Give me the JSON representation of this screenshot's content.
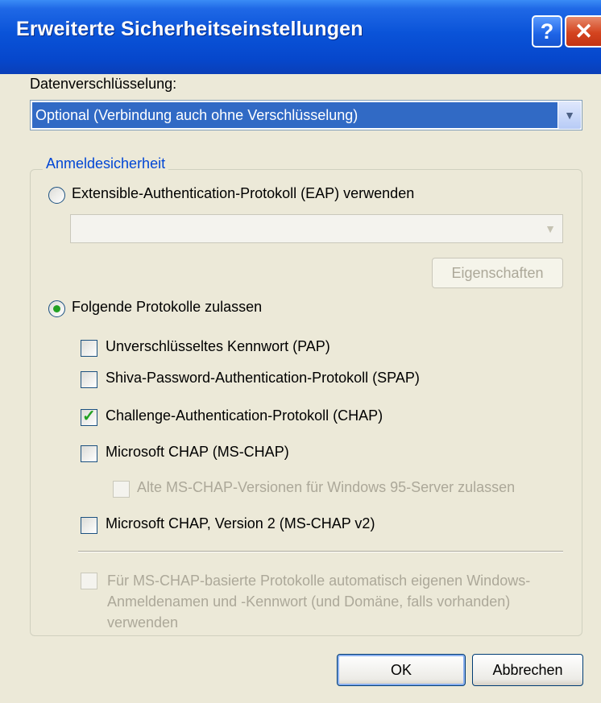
{
  "window": {
    "title": "Erweiterte Sicherheitseinstellungen",
    "help_label": "?",
    "close_label": "✕"
  },
  "encryption": {
    "label": "Datenverschlüsselung:",
    "selected": "Optional (Verbindung auch ohne Verschlüsselung)"
  },
  "logon_security": {
    "group_title": "Anmeldesicherheit",
    "eap_radio_label": "Extensible-Authentication-Protokoll (EAP) verwenden",
    "eap_selected": "",
    "properties_label": "Eigenschaften",
    "protocols_radio_label": "Folgende Protokolle zulassen",
    "protocols_selected": true,
    "protocols": [
      {
        "label": "Unverschlüsseltes Kennwort (PAP)",
        "checked": false,
        "enabled": true
      },
      {
        "label": "Shiva-Password-Authentication-Protokoll (SPAP)",
        "checked": false,
        "enabled": true
      },
      {
        "label": "Challenge-Authentication-Protokoll (CHAP)",
        "checked": true,
        "enabled": true
      },
      {
        "label": "Microsoft CHAP (MS-CHAP)",
        "checked": false,
        "enabled": true
      },
      {
        "label": "Alte MS-CHAP-Versionen für Windows 95-Server zulassen",
        "checked": false,
        "enabled": false
      },
      {
        "label": "Microsoft CHAP, Version 2 (MS-CHAP v2)",
        "checked": false,
        "enabled": true
      }
    ],
    "auto_logon_label": "Für MS-CHAP-basierte Protokolle automatisch eigenen Windows-Anmeldenamen und -Kennwort (und Domäne, falls vorhanden) verwenden"
  },
  "buttons": {
    "ok": "OK",
    "cancel": "Abbrechen"
  },
  "colors": {
    "title_bar": "#0a53d8",
    "selection": "#316ac5",
    "group_title": "#0046d5",
    "check_mark": "#21a121"
  }
}
